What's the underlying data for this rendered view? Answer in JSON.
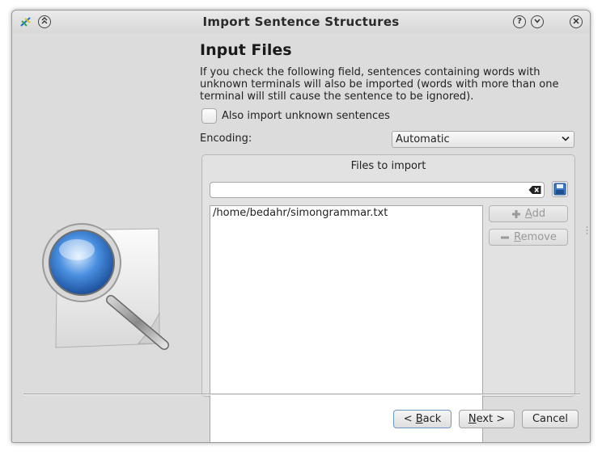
{
  "window": {
    "title": "Import Sentence Structures"
  },
  "page": {
    "heading": "Input Files",
    "description": "If you check the following field, sentences containing words with unknown terminals will also be imported (words with more than one terminal will still cause the sentence to be ignored).",
    "checkbox_label": "Also import unknown sentences",
    "encoding_label": "Encoding:",
    "encoding_value": "Automatic"
  },
  "files": {
    "group_title": "Files to import",
    "input_value": "",
    "list": [
      "/home/bedahr/simongrammar.txt"
    ],
    "add_accel": "A",
    "add_rest": "dd",
    "remove_accel": "R",
    "remove_rest": "emove"
  },
  "footer": {
    "back_prefix": "< ",
    "back_accel": "B",
    "back_rest": "ack",
    "next_accel": "N",
    "next_rest": "ext >",
    "cancel": "Cancel"
  },
  "icons": {
    "app": "simon-app-icon",
    "shade": "shade-up-icon",
    "help": "help-icon",
    "minimize": "minimize-icon",
    "close": "close-icon",
    "illustration": "document-magnifier-icon",
    "clear": "clear-text-icon",
    "save": "floppy-save-icon",
    "add": "plus-icon",
    "remove": "minus-icon",
    "dropdown": "chevron-down-icon"
  },
  "colors": {
    "window_bg": "#dcdcdc",
    "focus_border": "#6b95c4",
    "disabled_text": "#999999"
  }
}
